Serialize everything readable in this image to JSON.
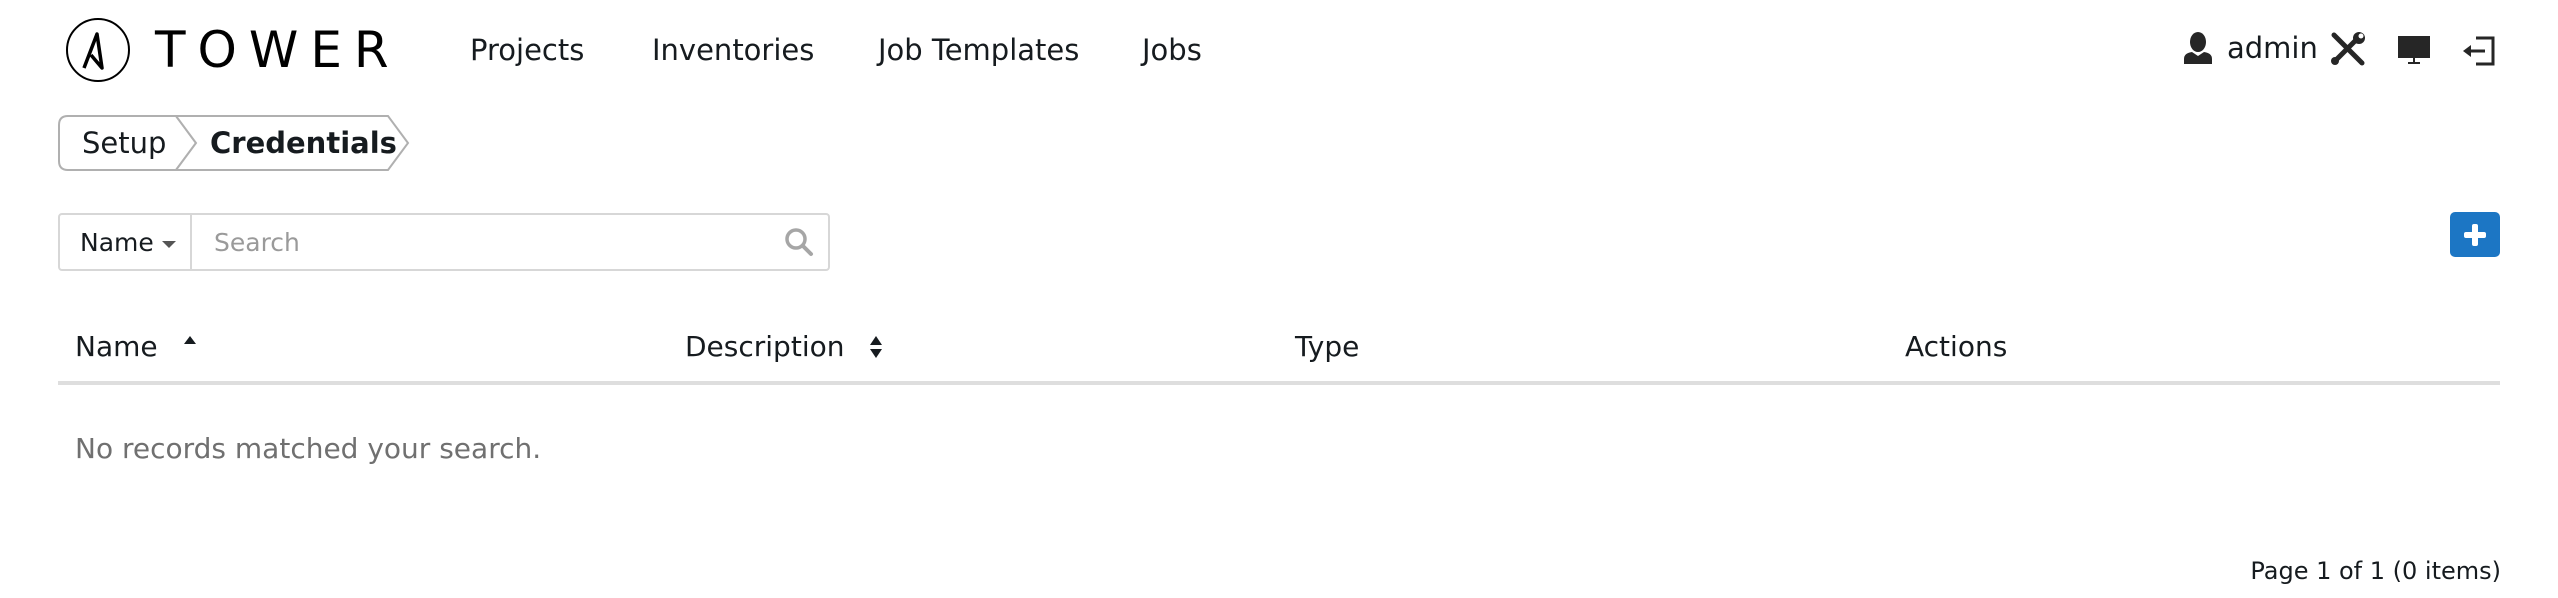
{
  "app": {
    "brand": "TOWER"
  },
  "nav": {
    "items": [
      {
        "label": "Projects"
      },
      {
        "label": "Inventories"
      },
      {
        "label": "Job Templates"
      },
      {
        "label": "Jobs"
      }
    ],
    "user": {
      "icon": "user-icon",
      "username": "admin"
    },
    "icons": {
      "settings": "tools-icon",
      "portal": "monitor-icon",
      "logout": "logout-icon"
    }
  },
  "breadcrumb": {
    "items": [
      {
        "label": "Setup"
      },
      {
        "label": "Credentials"
      }
    ]
  },
  "search": {
    "field_selected": "Name",
    "value": "",
    "placeholder": "Search",
    "icon": "search-icon"
  },
  "toolbar": {
    "add_icon": "plus-icon",
    "add_color": "#1c76c4"
  },
  "table": {
    "columns": [
      {
        "label": "Name",
        "sort": "ascending"
      },
      {
        "label": "Description",
        "sort": "sortable"
      },
      {
        "label": "Type",
        "sort": "none"
      },
      {
        "label": "Actions",
        "sort": "none"
      }
    ],
    "rows": [],
    "empty_message": "No records matched your search."
  },
  "pagination": {
    "text": "Page 1 of 1 (0 items)"
  }
}
